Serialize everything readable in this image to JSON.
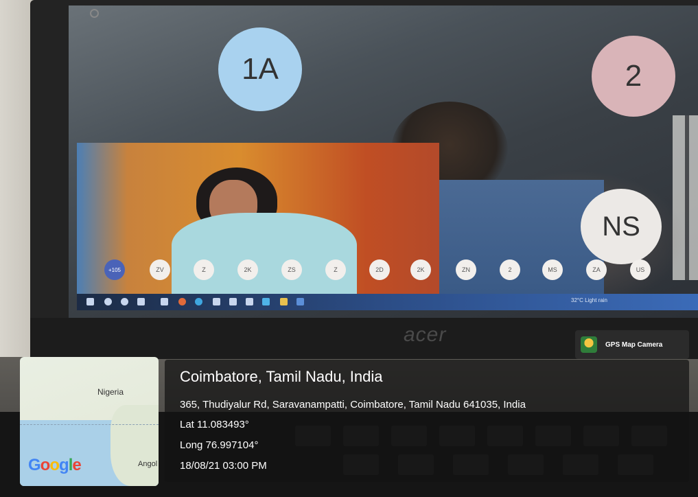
{
  "screen": {
    "tiles": [
      {
        "label": "1A",
        "color": "#a9d2ef"
      },
      {
        "label": "2",
        "color": "#d9b4b8"
      },
      {
        "label": "NS",
        "color": "#ece9e6"
      }
    ],
    "participant_bubbles": [
      "+105",
      "ZV",
      "Z",
      "2K",
      "ZS",
      "Z",
      "2D",
      "2K",
      "ZN",
      "2",
      "MS",
      "ZA",
      "US"
    ],
    "taskbar_status": "32°C Light rain"
  },
  "laptop": {
    "brand": "acer"
  },
  "gps_badge": {
    "label": "GPS Map Camera",
    "icon": "gps-map-camera-icon"
  },
  "map": {
    "label_country_1": "Nigeria",
    "label_country_2": "Angol",
    "provider": "Google"
  },
  "geo": {
    "location": "Coimbatore, Tamil Nadu, India",
    "address": "365, Thudiyalur Rd, Saravanampatti, Coimbatore, Tamil Nadu 641035, India",
    "lat": "Lat 11.083493°",
    "long": "Long 76.997104°",
    "datetime": "18/08/21 03:00 PM"
  }
}
